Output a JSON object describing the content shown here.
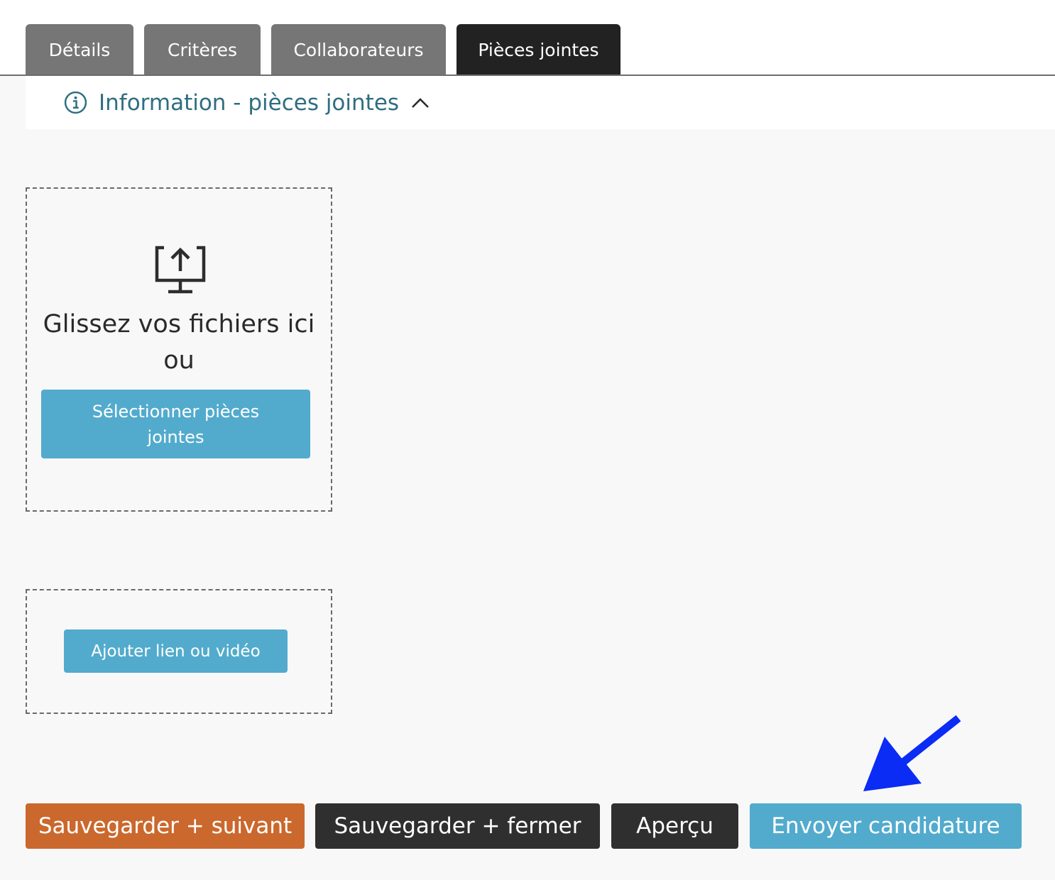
{
  "tabs": [
    {
      "label": "Détails"
    },
    {
      "label": "Critères"
    },
    {
      "label": "Collaborateurs"
    },
    {
      "label": "Pièces jointes",
      "active": true
    }
  ],
  "info_panel": {
    "label": "Information - pièces jointes",
    "icons": [
      "info-circle-icon",
      "chevron-up-icon"
    ]
  },
  "dropzone": {
    "icon": "upload-monitor-icon",
    "line1": "Glissez vos fichiers ici",
    "line2": "ou",
    "select_button": "Sélectionner pièces jointes"
  },
  "linkzone": {
    "add_link_button": "Ajouter lien ou vidéo"
  },
  "actions": {
    "save_next": "Sauvegarder + suivant",
    "save_close": "Sauvegarder + fermer",
    "preview": "Aperçu",
    "submit": "Envoyer candidature"
  },
  "annotation": {
    "icon": "arrow-icon"
  },
  "colors": {
    "tab_inactive": "#767676",
    "tab_active": "#222222",
    "info_text": "#2f6e80",
    "primary_blue": "#52abcd",
    "save_next_orange": "#cb682d",
    "dark_button": "#2f2f2f",
    "annotation_arrow": "#0a2cf5",
    "content_background": "#f8f8f8"
  }
}
